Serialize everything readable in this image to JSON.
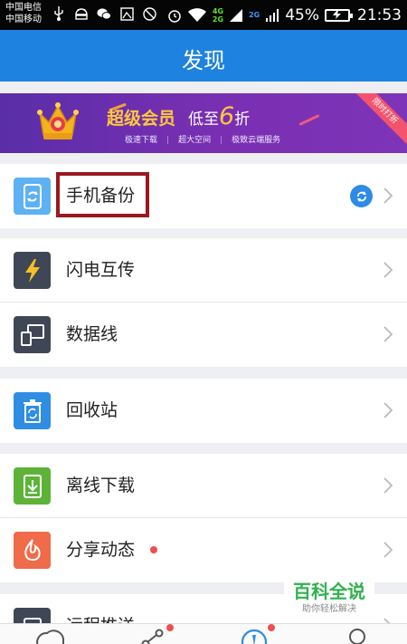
{
  "status_bar": {
    "carrier_1": "中国电信",
    "carrier_2": "中国移动",
    "net_top": "4G",
    "net_bottom": "2G",
    "net_top_2": "2G",
    "battery": "45%",
    "time": "21:53",
    "icons": [
      "usb-icon",
      "android-icon",
      "wechat-icon",
      "image-icon",
      "block-icon",
      "alarm-icon",
      "wifi-icon",
      "signal-icon",
      "battery-charging-icon"
    ]
  },
  "header": {
    "title": "发现"
  },
  "banner": {
    "title": "超级会员",
    "discount_prefix": "低至",
    "discount_value": "6",
    "discount_suffix": "折",
    "features": [
      "极速下载",
      "超大空间",
      "极致云端服务"
    ],
    "ribbon": "限时打折"
  },
  "groups": [
    {
      "items": [
        {
          "label": "手机备份",
          "icon": "phone-backup-icon",
          "icon_color": "#5eb1f2",
          "badge": "sync-icon"
        }
      ]
    },
    {
      "items": [
        {
          "label": "闪电互传",
          "icon": "lightning-icon",
          "icon_color": "#3f4655"
        },
        {
          "label": "数据线",
          "icon": "data-cable-icon",
          "icon_color": "#3f4655"
        }
      ]
    },
    {
      "items": [
        {
          "label": "回收站",
          "icon": "recycle-bin-icon",
          "icon_color": "#2f8de4"
        }
      ]
    },
    {
      "items": [
        {
          "label": "离线下载",
          "icon": "offline-download-icon",
          "icon_color": "#5cb338"
        },
        {
          "label": "分享动态",
          "icon": "share-feed-icon",
          "icon_color": "#ef6b4a",
          "new_dot": true
        }
      ]
    },
    {
      "items": [
        {
          "label": "远程推送",
          "icon": "remote-push-icon",
          "icon_color": "#3f4655"
        }
      ]
    }
  ],
  "bottom_nav": {
    "items": [
      "cloud-icon",
      "share-icon",
      "discover-icon",
      "profile-icon"
    ],
    "dots": [
      true,
      true,
      false,
      false
    ]
  },
  "watermark": {
    "title": "百科全说",
    "subtitle": "助你轻松解决"
  },
  "colors": {
    "header": "#1d82e0",
    "highlight_box": "#9a1820",
    "banner_gold": "#ffc83d"
  }
}
